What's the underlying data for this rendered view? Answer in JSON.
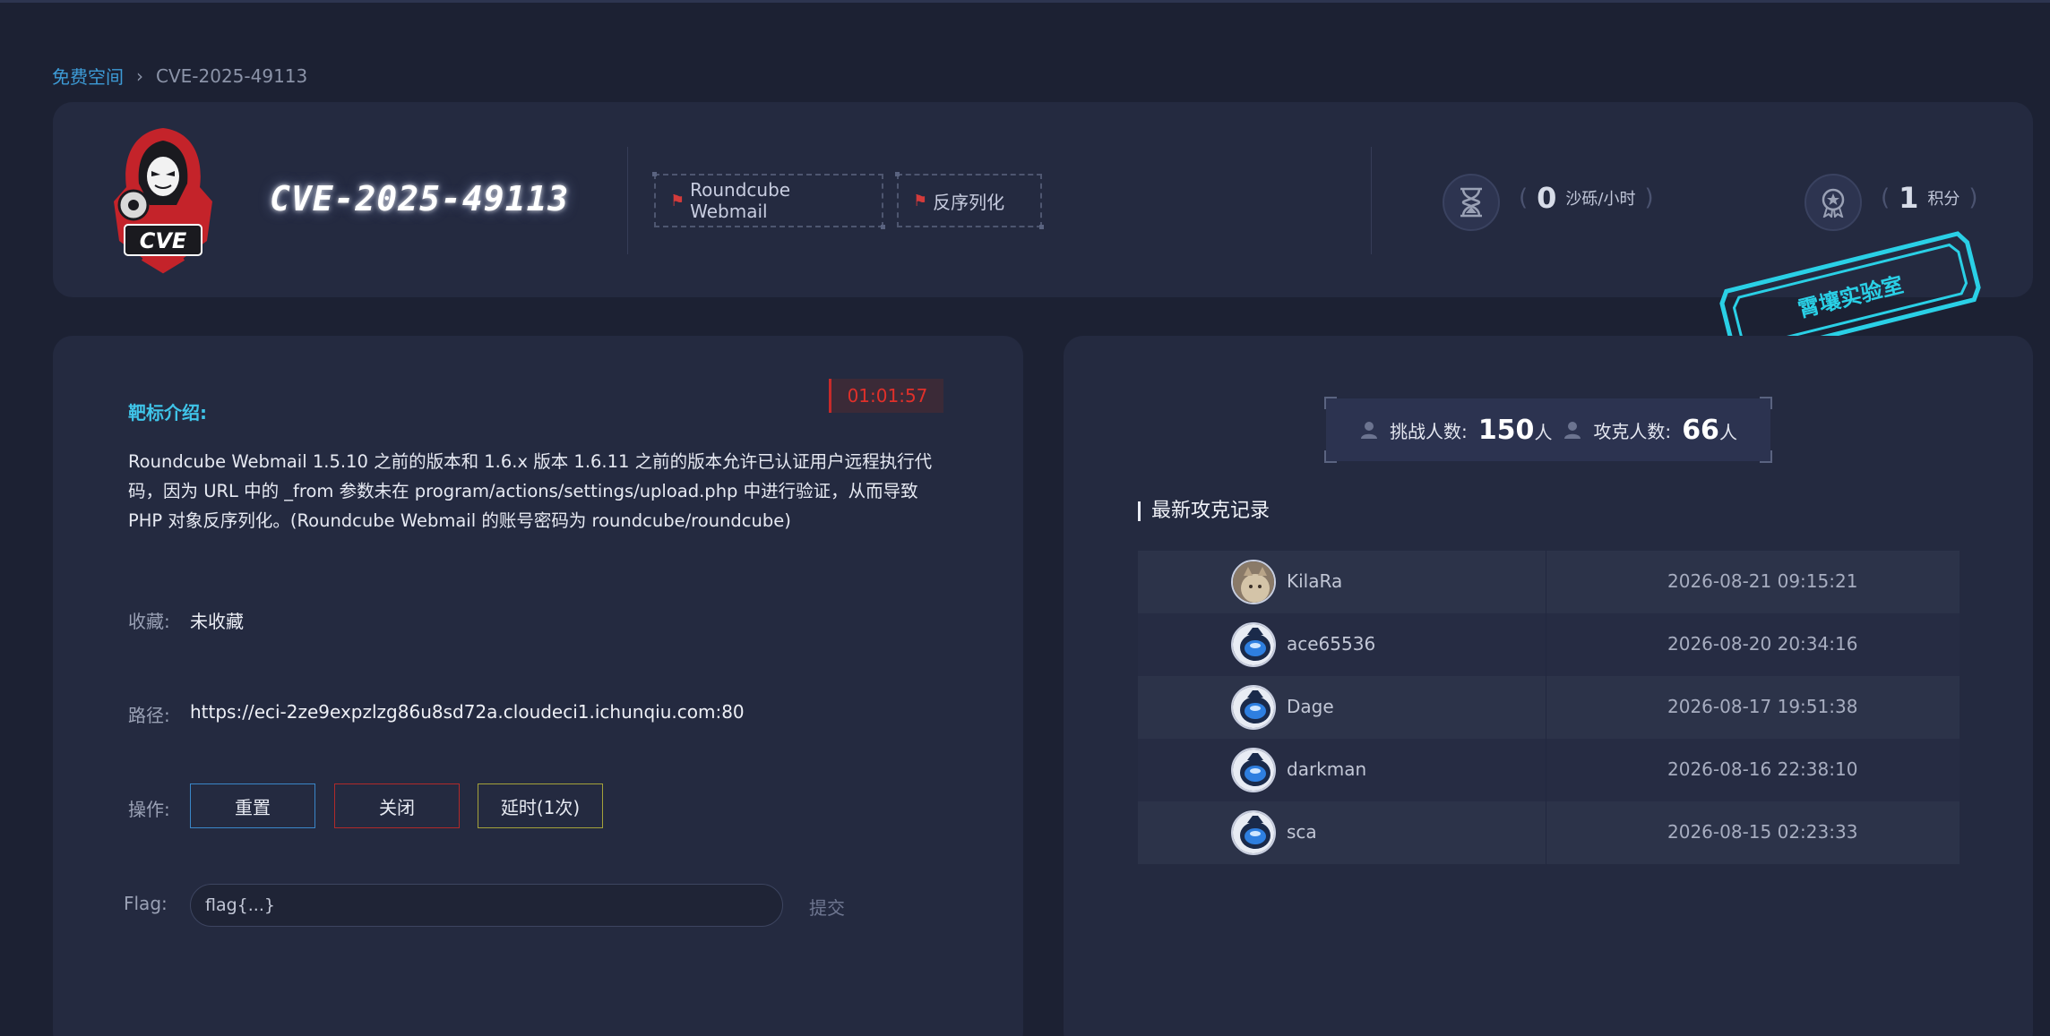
{
  "breadcrumb": {
    "home": "免费空间",
    "separator": "›",
    "current": "CVE-2025-49113"
  },
  "header": {
    "title": "CVE-2025-49113",
    "logo_text": "CVE",
    "tags": [
      "Roundcube Webmail",
      "反序列化"
    ],
    "sand": {
      "value": "0",
      "unit": "沙砾/小时"
    },
    "points": {
      "value": "1",
      "unit": "积分"
    },
    "stamp": "霄壤实验室"
  },
  "challenge": {
    "timer": "01:01:57",
    "intro_label": "靶标介绍:",
    "description": "Roundcube Webmail 1.5.10 之前的版本和 1.6.x 版本 1.6.11 之前的版本允许已认证用户远程执行代码，因为 URL 中的 _from 参数未在 program/actions/settings/upload.php 中进行验证，从而导致 PHP 对象反序列化。(Roundcube Webmail 的账号密码为 roundcube/roundcube)",
    "favorite_label": "收藏:",
    "favorite_value": "未收藏",
    "path_label": "路径:",
    "path_value": "https://eci-2ze9expzlzg86u8sd72a.cloudeci1.ichunqiu.com:80",
    "ops_label": "操作:",
    "buttons": {
      "reset": "重置",
      "close": "关闭",
      "extend": "延时(1次)"
    },
    "flag_label": "Flag:",
    "flag_placeholder": "flag{...}",
    "submit": "提交"
  },
  "stats": {
    "challengers_label": "挑战人数:",
    "challengers": "150",
    "solvers_label": "攻克人数:",
    "solvers": "66",
    "unit": "人"
  },
  "records": {
    "title": "最新攻克记录",
    "rows": [
      {
        "name": "KilaRa",
        "time": "2026-08-21 09:15:21"
      },
      {
        "name": "ace65536",
        "time": "2026-08-20 20:34:16"
      },
      {
        "name": "Dage",
        "time": "2026-08-17 19:51:38"
      },
      {
        "name": "darkman",
        "time": "2026-08-16 22:38:10"
      },
      {
        "name": "sca",
        "time": "2026-08-15 02:23:33"
      }
    ]
  },
  "colors": {
    "accent_cyan": "#3fc4e8",
    "danger": "#e0302a",
    "reset_border": "#3a86c8",
    "close_border": "#b02a2a",
    "extend_border": "#a4a13a"
  }
}
